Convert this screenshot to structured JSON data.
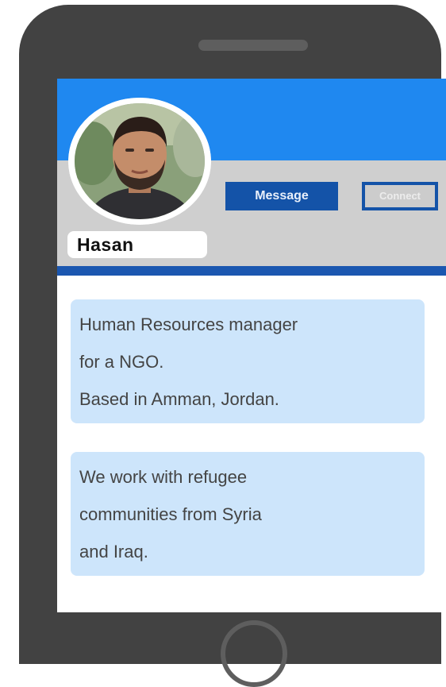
{
  "profile": {
    "name": "Hasan",
    "avatar_icon": "person-photo"
  },
  "actions": {
    "message_label": "Message",
    "connect_label": "Connect"
  },
  "bio": {
    "card1_lines": [
      "Human Resources manager",
      "for a NGO.",
      "Based in Amman, Jordan."
    ],
    "card2_lines": [
      "We work with refugee",
      "communities from Syria",
      "and Iraq."
    ]
  },
  "colors": {
    "phone_body": "#424242",
    "header_blue": "#1f88f0",
    "header_gray": "#cfcfcf",
    "accent_dark_blue": "#1453a8",
    "card_background": "#cde5fb",
    "card_text": "#444444"
  }
}
